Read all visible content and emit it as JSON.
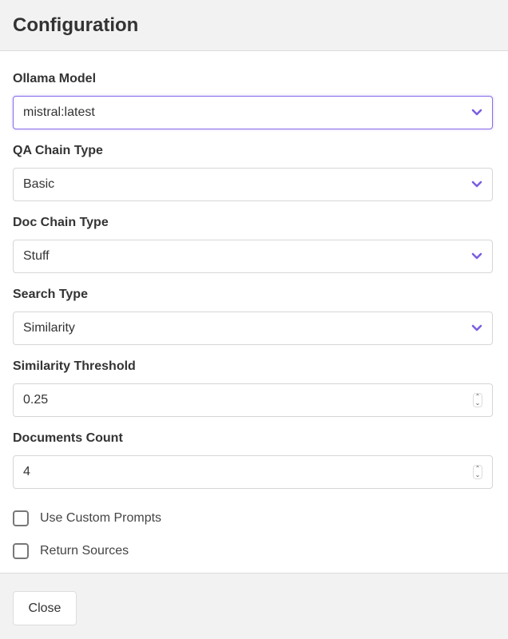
{
  "header": {
    "title": "Configuration"
  },
  "fields": [
    {
      "label": "Ollama Model",
      "value": "mistral:latest"
    },
    {
      "label": "QA Chain Type",
      "value": "Basic"
    },
    {
      "label": "Doc Chain Type",
      "value": "Stuff"
    },
    {
      "label": "Search Type",
      "value": "Similarity"
    },
    {
      "label": "Similarity Threshold",
      "value": "0.25"
    },
    {
      "label": "Documents Count",
      "value": "4"
    }
  ],
  "checkboxes": [
    {
      "label": "Use Custom Prompts",
      "checked": false
    },
    {
      "label": "Return Sources",
      "checked": false
    }
  ],
  "footer": {
    "close_label": "Close"
  },
  "colors": {
    "accent": "#7b5fe0"
  }
}
